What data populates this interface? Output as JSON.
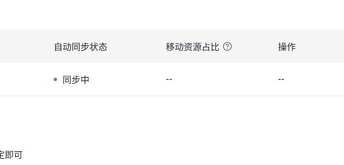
{
  "table": {
    "headers": {
      "status": "自动同步状态",
      "ratio": "移动资源占比",
      "ops": "操作"
    },
    "row": {
      "status_text": "同步中",
      "status_dot_color": "#5e7ce0",
      "ratio": "--",
      "ops": "--"
    },
    "help_icon": "question-circle-icon"
  },
  "footer": {
    "text": "定即可"
  },
  "colors": {
    "header_bg": "#f5f5f6",
    "border": "#e5e7eb",
    "text": "#252b3a"
  }
}
